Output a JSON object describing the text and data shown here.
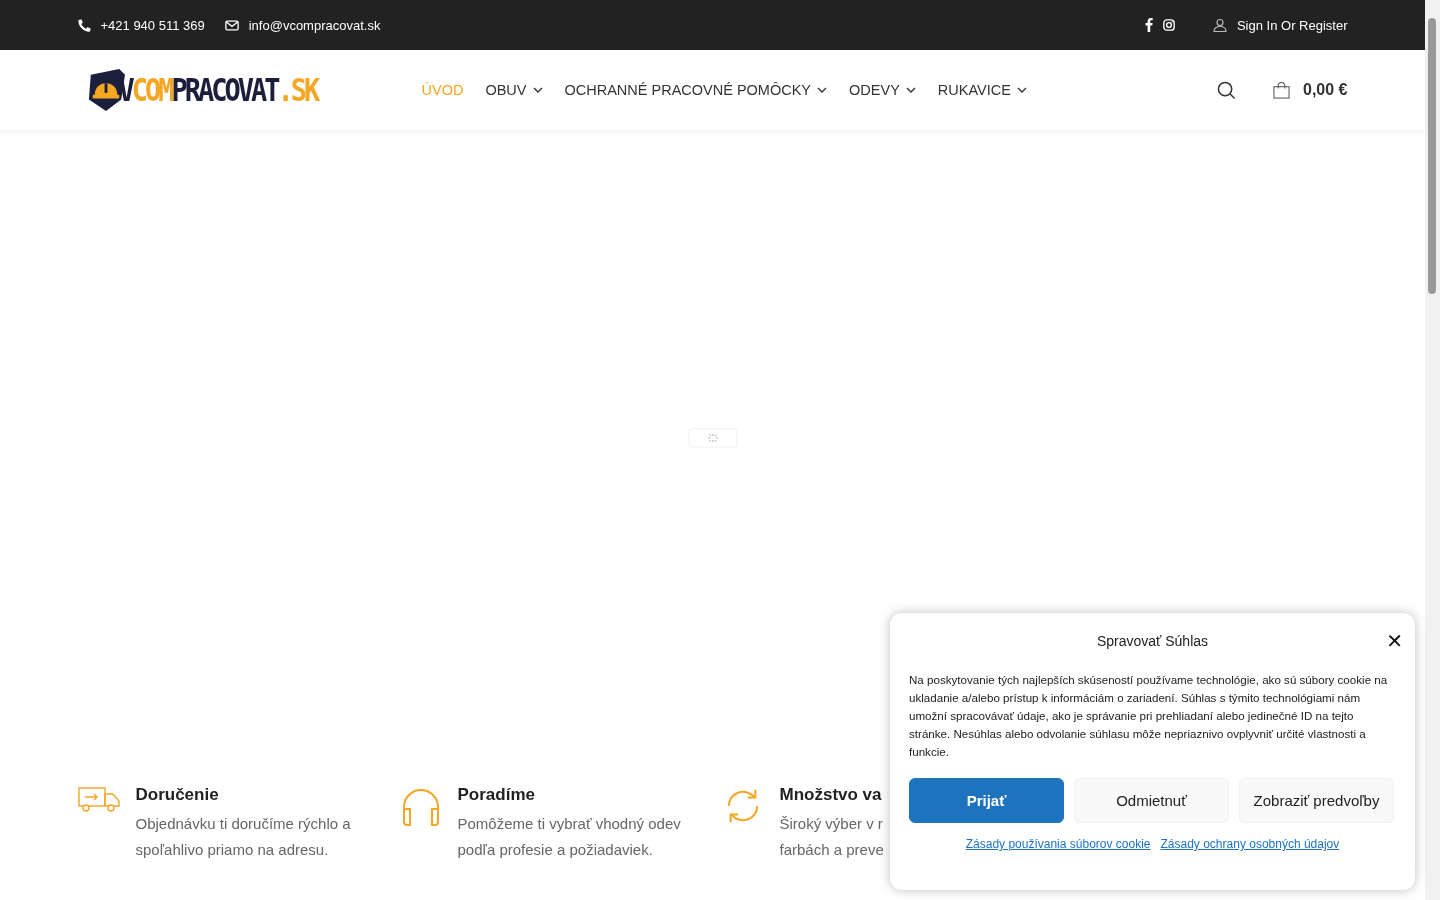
{
  "top_bar": {
    "phone": "+421 940 511 369",
    "email": "info@vcompracovat.sk",
    "account": "Sign In Or Register"
  },
  "logo": {
    "parts": [
      {
        "text": "V",
        "color": "#1b1f3b"
      },
      {
        "text": "COM",
        "color": "#f5a623"
      },
      {
        "text": "PRACOVAT",
        "color": "#1b1f3b"
      },
      {
        "text": ".SK",
        "color": "#f5a623"
      }
    ]
  },
  "nav": [
    {
      "label": "ÚVOD",
      "selected": true,
      "dropdown": false
    },
    {
      "label": "OBUV",
      "selected": false,
      "dropdown": true
    },
    {
      "label": "OCHRANNÉ PRACOVNÉ POMÔCKY",
      "selected": false,
      "dropdown": true
    },
    {
      "label": "ODEVY",
      "selected": false,
      "dropdown": true
    },
    {
      "label": "RUKAVICE",
      "selected": false,
      "dropdown": true
    }
  ],
  "cart": {
    "total": "0,00 €"
  },
  "features": [
    {
      "kind": "truck",
      "title": "Doručenie",
      "lines": [
        "Objednávku ti doručíme rýchlo a",
        "spoľahlivo priamo na adresu."
      ]
    },
    {
      "kind": "headphones",
      "title": "Poradíme",
      "lines": [
        "Pomôžeme ti vybrať vhodný odev",
        "podľa profesie a požiadaviek."
      ]
    },
    {
      "kind": "refresh",
      "title": "Množstvo va",
      "lines": [
        "Široký výber v r",
        "farbách a preve"
      ]
    }
  ],
  "consent": {
    "title": "Spravovať Súhlas",
    "close": "✕",
    "text": "Na poskytovanie tých najlepších skúseností používame technológie, ako sú súbory cookie na ukladanie a/alebo prístup k informáciám o zariadení. Súhlas s týmito technológiami nám umožní spracovávať údaje, ako je správanie pri prehliadaní alebo jedinečné ID na tejto stránke. Nesúhlas alebo odvolanie súhlasu môže nepriaznivo ovplyvniť určité vlastnosti a funkcie.",
    "buttons": [
      {
        "label": "Prijať",
        "kind": "primary"
      },
      {
        "label": "Odmietnuť",
        "kind": "secondary"
      },
      {
        "label": "Zobraziť predvoľby",
        "kind": "secondary"
      }
    ],
    "links": [
      "Zásady používania súborov cookie",
      "Zásady ochrany osobných údajov"
    ]
  }
}
